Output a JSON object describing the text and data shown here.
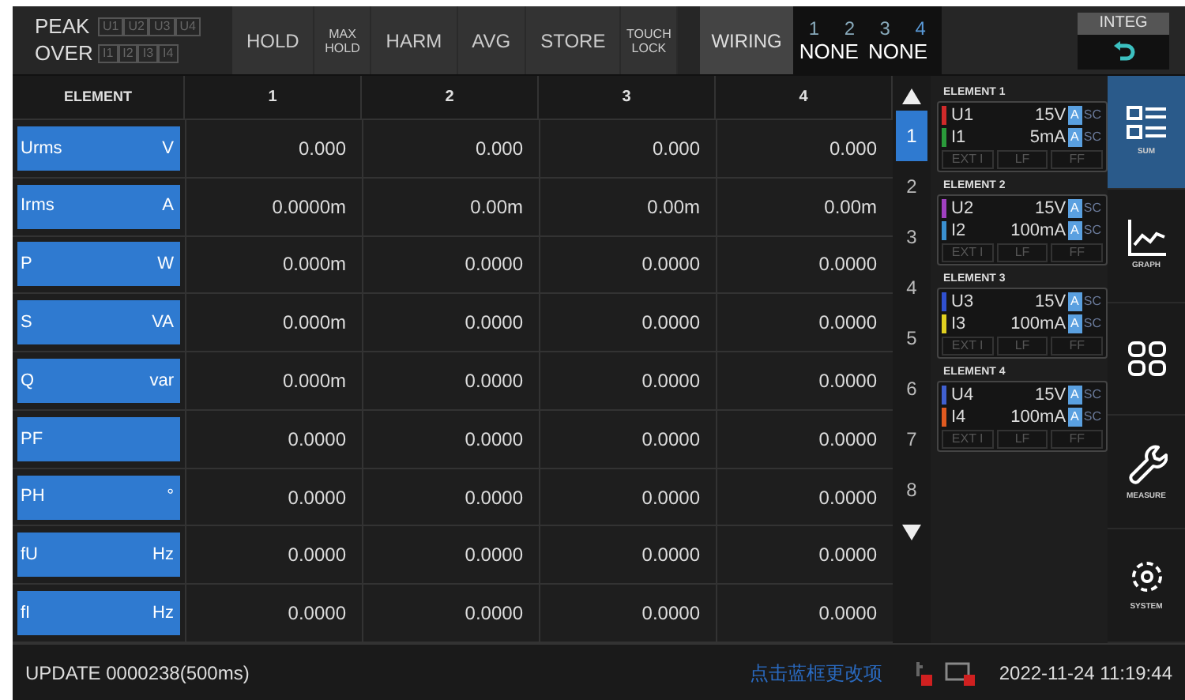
{
  "top_bar": {
    "peak_label": "PEAK",
    "peak_channels": [
      "U1",
      "U2",
      "U3",
      "U4"
    ],
    "over_label": "OVER",
    "over_channels": [
      "I1",
      "I2",
      "I3",
      "I4"
    ],
    "buttons": [
      {
        "label": "HOLD",
        "small": false
      },
      {
        "label": "MAX HOLD",
        "small": true
      },
      {
        "label": "HARM",
        "small": false
      },
      {
        "label": "AVG",
        "small": false
      },
      {
        "label": "STORE",
        "small": false
      },
      {
        "label": "TOUCH LOCK",
        "small": true
      }
    ],
    "wiring": {
      "label": "WIRING",
      "numbers": [
        "1",
        "2",
        "3",
        "4"
      ],
      "values": [
        "NONE",
        "NONE"
      ]
    },
    "integ": {
      "label": "INTEG"
    }
  },
  "table": {
    "header": "ELEMENT",
    "columns": [
      "1",
      "2",
      "3",
      "4"
    ],
    "rows": [
      {
        "name": "Urms",
        "unit": "V",
        "values": [
          "0.000",
          "0.000",
          "0.000",
          "0.000"
        ]
      },
      {
        "name": "Irms",
        "unit": "A",
        "values": [
          "0.0000m",
          "0.00m",
          "0.00m",
          "0.00m"
        ]
      },
      {
        "name": "P",
        "unit": "W",
        "values": [
          "0.000m",
          "0.0000",
          "0.0000",
          "0.0000"
        ]
      },
      {
        "name": "S",
        "unit": "VA",
        "values": [
          "0.000m",
          "0.0000",
          "0.0000",
          "0.0000"
        ]
      },
      {
        "name": "Q",
        "unit": "var",
        "values": [
          "0.000m",
          "0.0000",
          "0.0000",
          "0.0000"
        ]
      },
      {
        "name": "PF",
        "unit": "",
        "values": [
          "0.0000",
          "0.0000",
          "0.0000",
          "0.0000"
        ]
      },
      {
        "name": "PH",
        "unit": "°",
        "values": [
          "0.0000",
          "0.0000",
          "0.0000",
          "0.0000"
        ]
      },
      {
        "name": "fU",
        "unit": "Hz",
        "values": [
          "0.0000",
          "0.0000",
          "0.0000",
          "0.0000"
        ]
      },
      {
        "name": "fI",
        "unit": "Hz",
        "values": [
          "0.0000",
          "0.0000",
          "0.0000",
          "0.0000"
        ]
      }
    ]
  },
  "pages": [
    {
      "label": "1",
      "selected": true
    },
    {
      "label": "2",
      "selected": false
    },
    {
      "label": "3",
      "selected": false
    },
    {
      "label": "4",
      "selected": false
    },
    {
      "label": "5",
      "selected": false
    },
    {
      "label": "6",
      "selected": false
    },
    {
      "label": "7",
      "selected": false
    },
    {
      "label": "8",
      "selected": false
    }
  ],
  "elements": [
    {
      "title": "ELEMENT 1",
      "channels": [
        {
          "name": "U1",
          "range": "15V",
          "color": "#d02a2a",
          "auto": "A",
          "sc": "SC"
        },
        {
          "name": "I1",
          "range": "5mA",
          "color": "#2a9a3a",
          "auto": "A",
          "sc": "SC"
        }
      ],
      "filters": [
        "EXT I",
        "LF",
        "FF"
      ]
    },
    {
      "title": "ELEMENT 2",
      "channels": [
        {
          "name": "U2",
          "range": "15V",
          "color": "#a040c0",
          "auto": "A",
          "sc": "SC"
        },
        {
          "name": "I2",
          "range": "100mA",
          "color": "#3a90d0",
          "auto": "A",
          "sc": "SC"
        }
      ],
      "filters": [
        "EXT I",
        "LF",
        "FF"
      ]
    },
    {
      "title": "ELEMENT 3",
      "channels": [
        {
          "name": "U3",
          "range": "15V",
          "color": "#3050d0",
          "auto": "A",
          "sc": "SC"
        },
        {
          "name": "I3",
          "range": "100mA",
          "color": "#e0d020",
          "auto": "A",
          "sc": "SC"
        }
      ],
      "filters": [
        "EXT I",
        "LF",
        "FF"
      ]
    },
    {
      "title": "ELEMENT 4",
      "channels": [
        {
          "name": "U4",
          "range": "15V",
          "color": "#4060d0",
          "auto": "A",
          "sc": "SC"
        },
        {
          "name": "I4",
          "range": "100mA",
          "color": "#e05a20",
          "auto": "A",
          "sc": "SC"
        }
      ],
      "filters": [
        "EXT I",
        "LF",
        "FF"
      ]
    }
  ],
  "sidebar": [
    {
      "kind": "sum",
      "label": "SUM",
      "selected": true
    },
    {
      "kind": "graph",
      "label": "GRAPH",
      "selected": false
    },
    {
      "kind": "grid",
      "selected": false
    },
    {
      "kind": "measure",
      "label": "MEASURE",
      "selected": false
    },
    {
      "kind": "system",
      "label": "SYSTEM",
      "selected": false
    }
  ],
  "status_bar": {
    "update": "UPDATE 0000238(500ms)",
    "hint": "点击蓝框更改项",
    "datetime": "2022-11-24 11:19:44"
  }
}
